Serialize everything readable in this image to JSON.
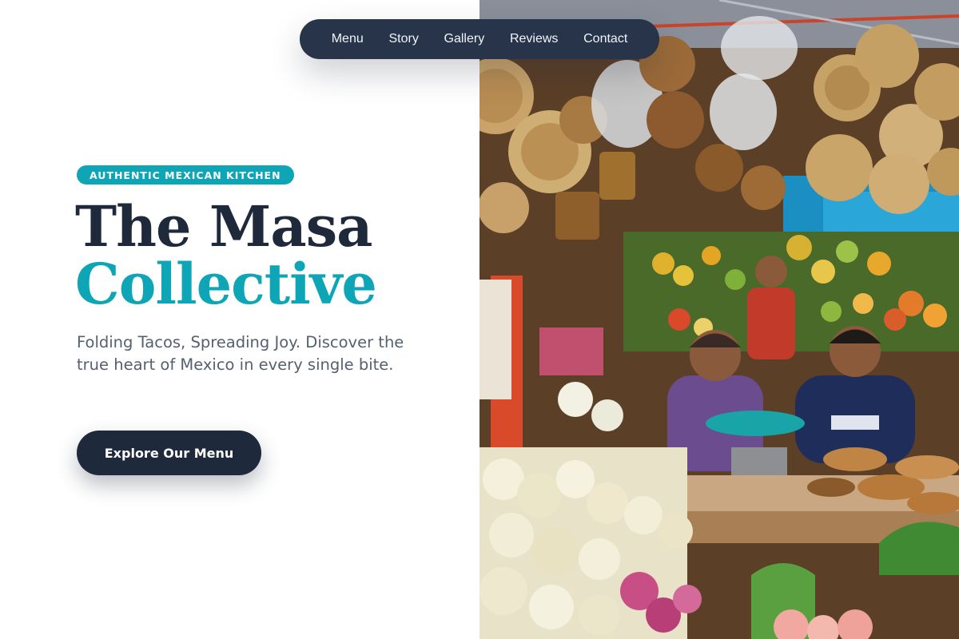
{
  "nav": {
    "items": [
      {
        "label": "Menu"
      },
      {
        "label": "Story"
      },
      {
        "label": "Gallery"
      },
      {
        "label": "Reviews"
      },
      {
        "label": "Contact"
      }
    ]
  },
  "hero": {
    "badge": "AUTHENTIC MEXICAN KITCHEN",
    "title_line_1": "The Masa",
    "title_line_2": "Collective",
    "subtitle": "Folding Tacos, Spreading Joy. Discover the true heart of Mexico in every single bite.",
    "cta_label": "Explore Our Menu"
  },
  "image": {
    "alt": "Mexican market stall with hanging baskets, fruit, flowers and vendors"
  },
  "colors": {
    "dark": "#1e293b",
    "nav_bg": "#27344a",
    "accent": "#0ea5b7",
    "body_text": "#55606f",
    "background": "#ffffff"
  }
}
